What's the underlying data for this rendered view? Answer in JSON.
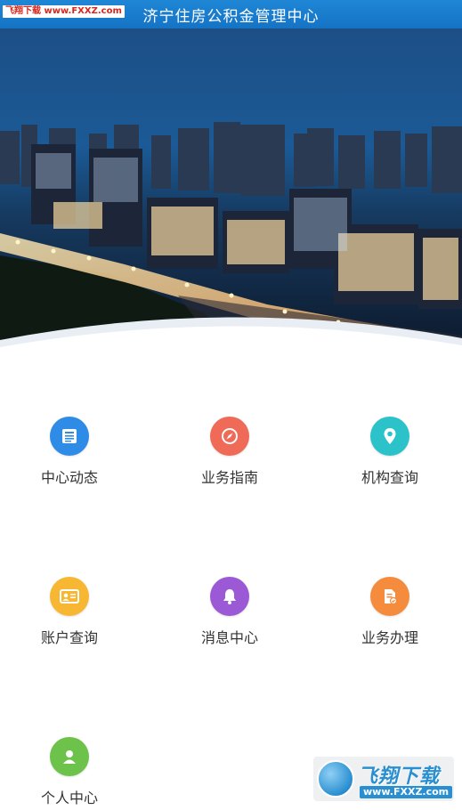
{
  "header": {
    "title": "济宁住房公积金管理中心",
    "watermark": "飞翔下载 www.FXXZ.com"
  },
  "banner": {
    "icon": "night-city-skyline-photo"
  },
  "menu": [
    {
      "label": "中心动态",
      "icon": "news-icon",
      "color": "#2e8be6"
    },
    {
      "label": "业务指南",
      "icon": "compass-icon",
      "color": "#ef6a57"
    },
    {
      "label": "机构查询",
      "icon": "location-pin-icon",
      "color": "#2cc2c9"
    },
    {
      "label": "账户查询",
      "icon": "account-card-icon",
      "color": "#f7b733"
    },
    {
      "label": "消息中心",
      "icon": "bell-icon",
      "color": "#9b59d6"
    },
    {
      "label": "业务办理",
      "icon": "document-check-icon",
      "color": "#f58b3c"
    },
    {
      "label": "个人中心",
      "icon": "user-icon",
      "color": "#6cc24a"
    }
  ],
  "watermark_bottom": {
    "name": "飞翔下载",
    "domain": "www.FXXZ.com"
  }
}
